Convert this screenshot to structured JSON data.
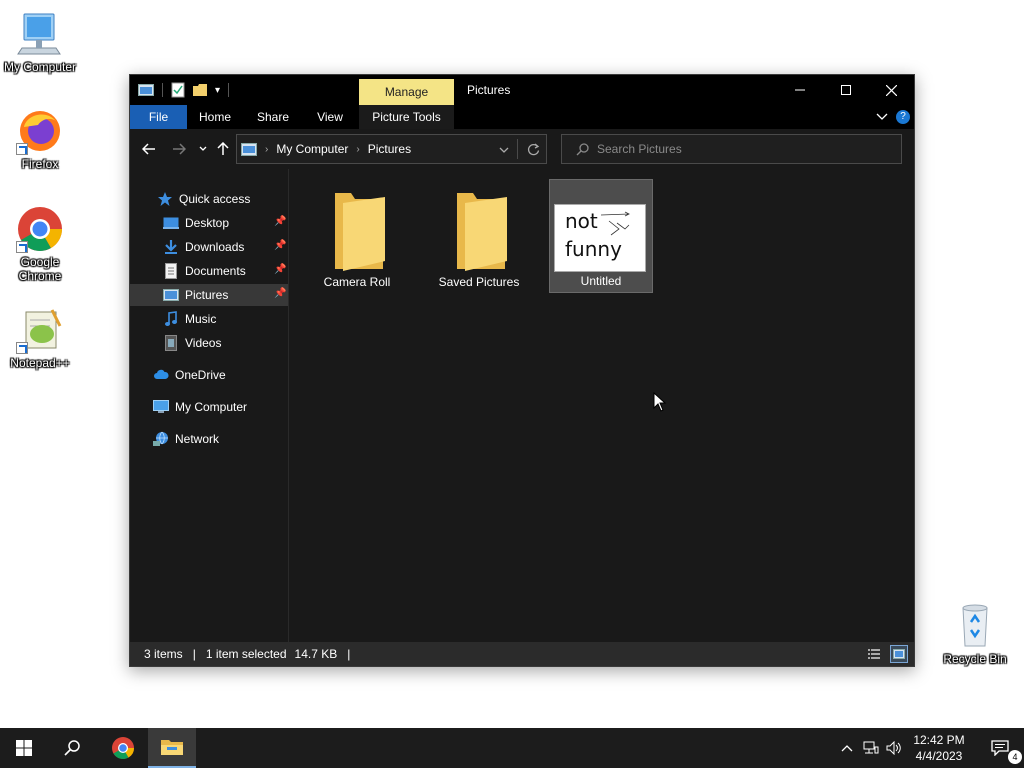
{
  "desktop": {
    "icons": [
      {
        "label": "My Computer"
      },
      {
        "label": "Firefox"
      },
      {
        "label": "Google Chrome"
      },
      {
        "label": "Notepad++"
      },
      {
        "label": "Recycle Bin"
      }
    ]
  },
  "window": {
    "title": "Pictures",
    "context_tab": "Manage",
    "ribbon_tabs": [
      "File",
      "Home",
      "Share",
      "View",
      "Picture Tools"
    ],
    "address": {
      "root": "My Computer",
      "current": "Pictures"
    },
    "search_placeholder": "Search Pictures",
    "sidebar": {
      "items": [
        {
          "label": "Quick access"
        },
        {
          "label": "Desktop"
        },
        {
          "label": "Downloads"
        },
        {
          "label": "Documents"
        },
        {
          "label": "Pictures"
        },
        {
          "label": "Music"
        },
        {
          "label": "Videos"
        },
        {
          "label": "OneDrive"
        },
        {
          "label": "My Computer"
        },
        {
          "label": "Network"
        }
      ]
    },
    "files": [
      {
        "name": "Camera Roll"
      },
      {
        "name": "Saved Pictures"
      },
      {
        "name": "Untitled",
        "thumb_text": [
          "not",
          "funny"
        ]
      }
    ],
    "status": {
      "items": "3 items",
      "selected": "1 item selected",
      "size": "14.7 KB"
    }
  },
  "taskbar": {
    "time": "12:42 PM",
    "date": "4/4/2023",
    "notification_count": "4"
  },
  "colors": {
    "accent": "#1a5fb4",
    "manage_tab": "#f4e486",
    "window_bg": "#191919"
  }
}
